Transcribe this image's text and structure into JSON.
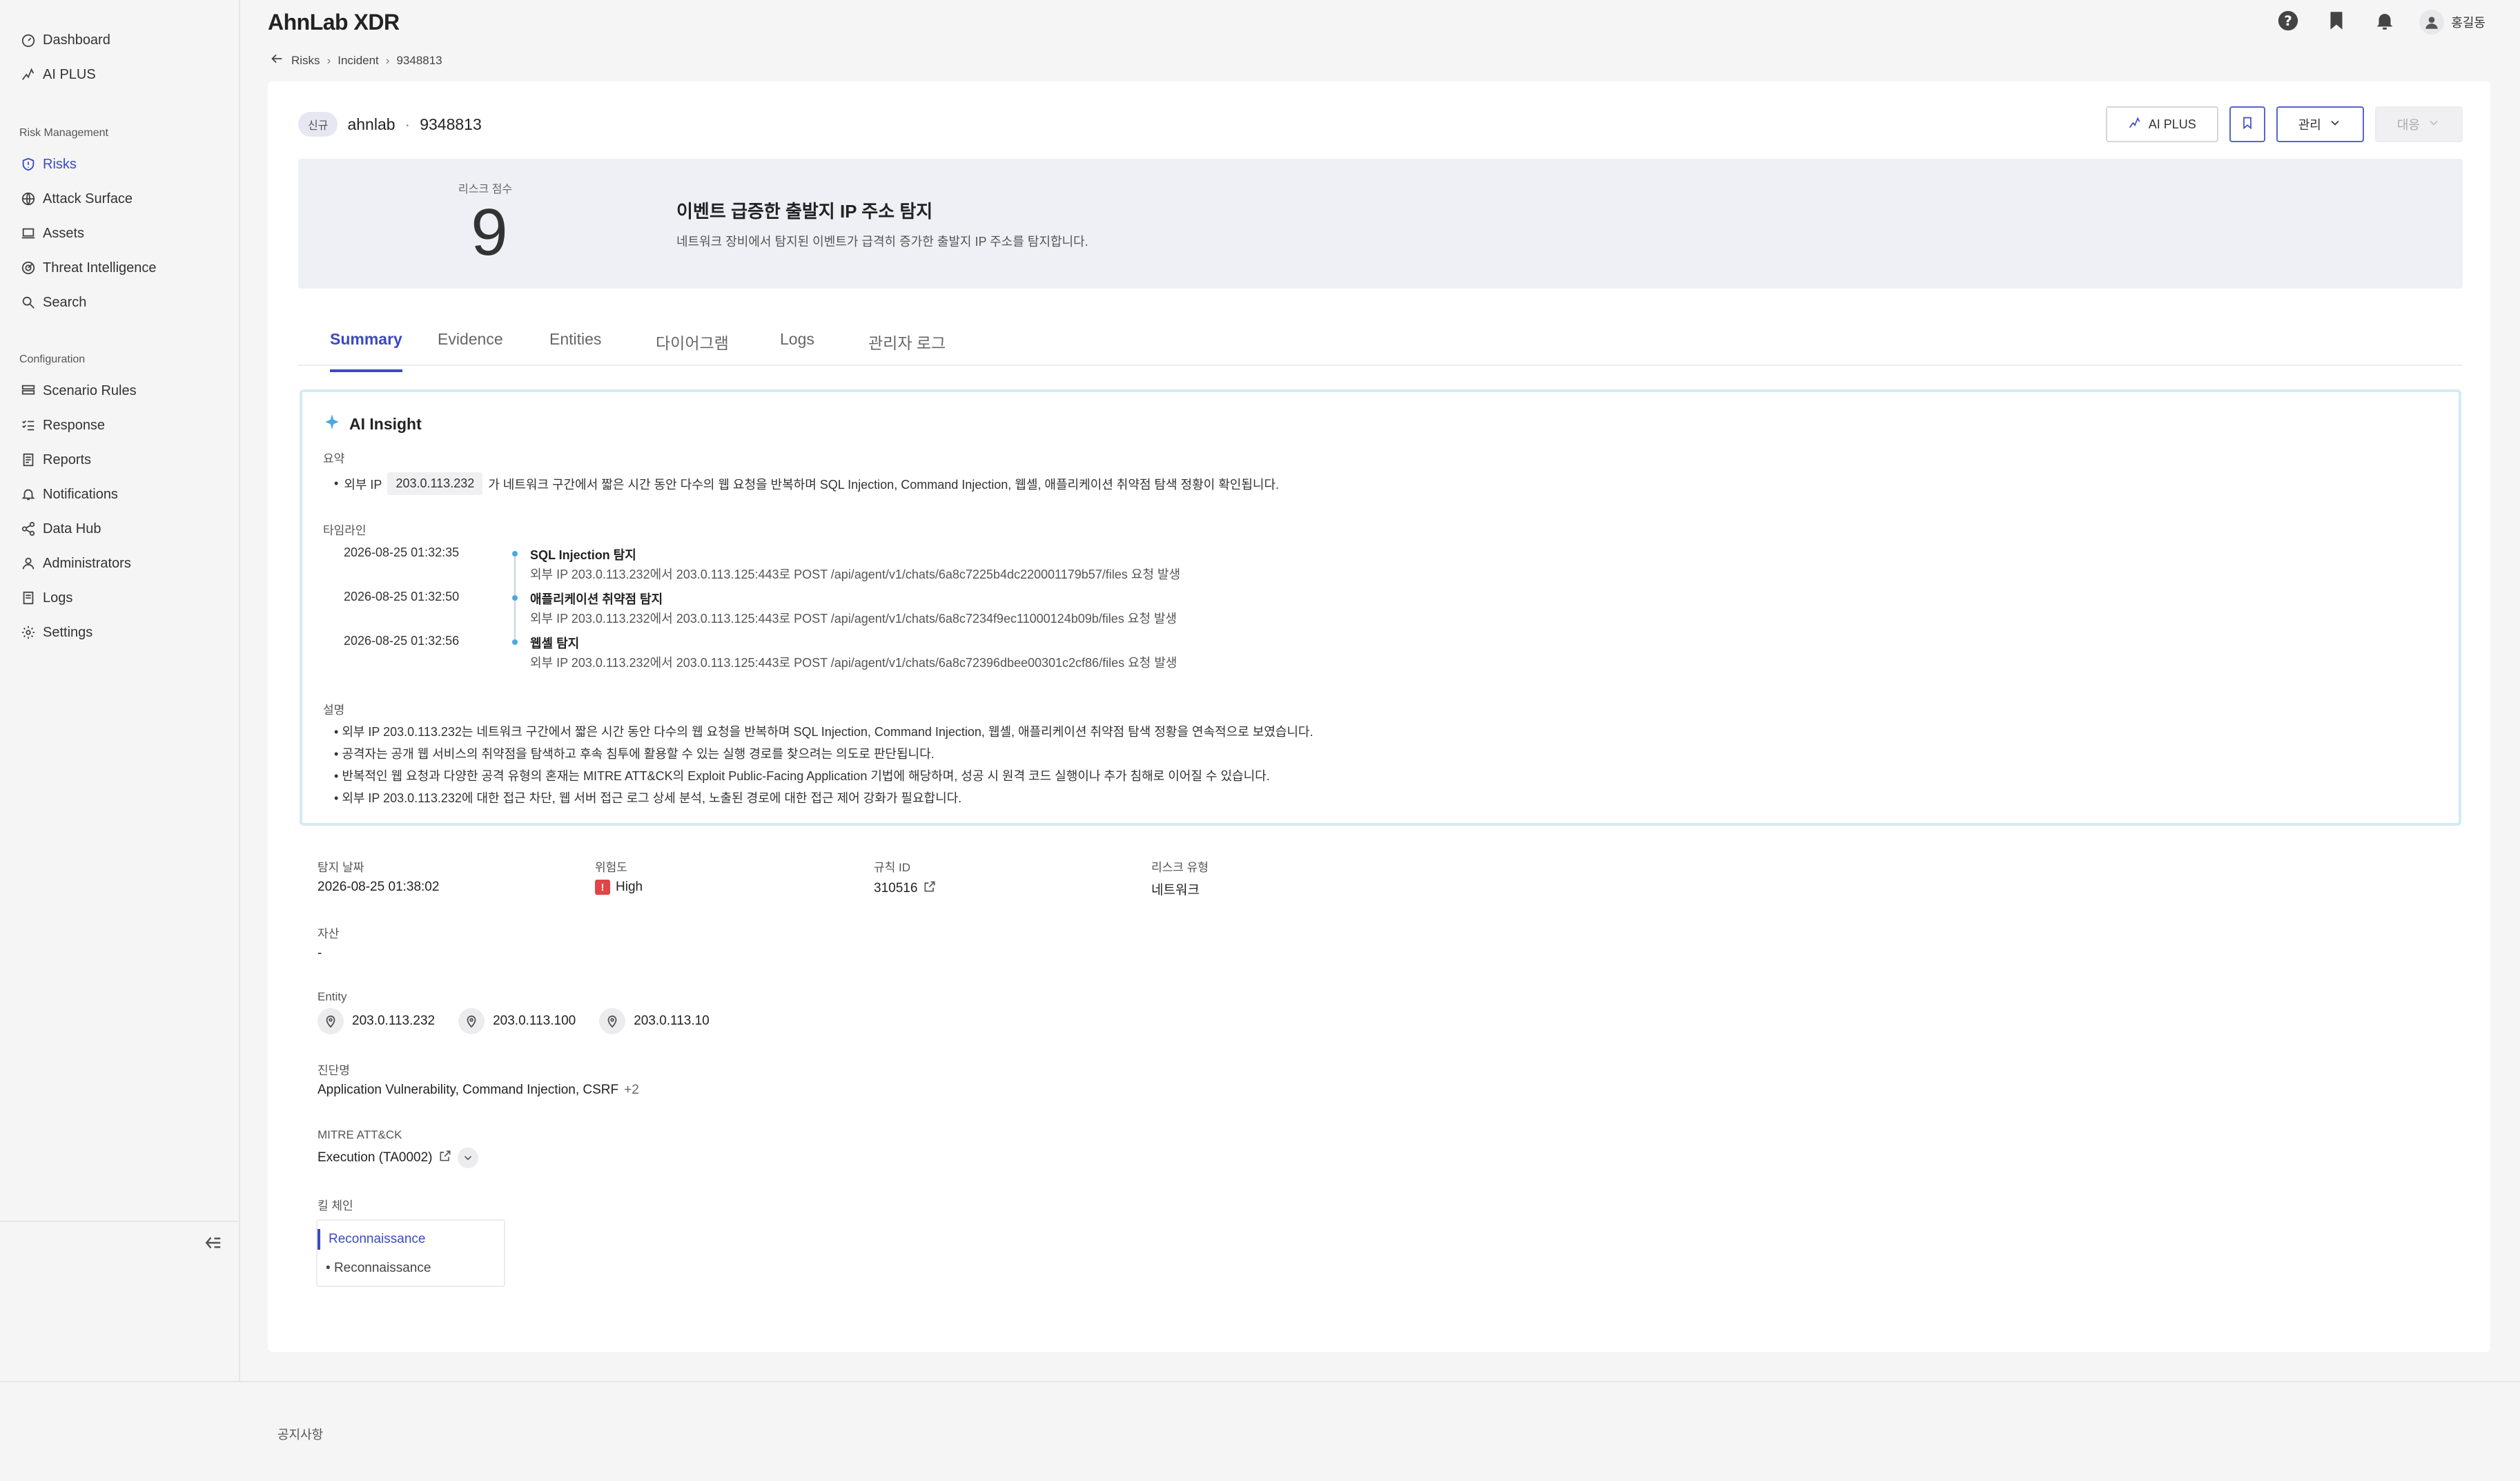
{
  "app": {
    "title": "AhnLab XDR"
  },
  "sidebar": {
    "top_items": [
      {
        "label": "Dashboard",
        "icon": "gauge-icon"
      },
      {
        "label": "AI PLUS",
        "icon": "sparkle-icon"
      }
    ],
    "risk_section": "Risk Management",
    "risk_items": [
      {
        "label": "Risks",
        "icon": "shield-icon",
        "active": true
      },
      {
        "label": "Attack Surface",
        "icon": "globe-icon"
      },
      {
        "label": "Assets",
        "icon": "laptop-icon"
      },
      {
        "label": "Threat Intelligence",
        "icon": "radar-icon"
      },
      {
        "label": "Search",
        "icon": "search-icon"
      }
    ],
    "config_section": "Configuration",
    "config_items": [
      {
        "label": "Scenario Rules",
        "icon": "stack-icon"
      },
      {
        "label": "Response",
        "icon": "checklist-icon"
      },
      {
        "label": "Reports",
        "icon": "report-icon"
      },
      {
        "label": "Notifications",
        "icon": "bell-icon"
      },
      {
        "label": "Data Hub",
        "icon": "share-icon"
      },
      {
        "label": "Administrators",
        "icon": "user-icon"
      },
      {
        "label": "Logs",
        "icon": "log-icon"
      },
      {
        "label": "Settings",
        "icon": "gear-icon"
      }
    ]
  },
  "header": {
    "user_name": "홍길동"
  },
  "breadcrumb": {
    "items": [
      "Risks",
      "Incident",
      "9348813"
    ]
  },
  "incident": {
    "status_badge": "신규",
    "tenant": "ahnlab",
    "id": "9348813",
    "actions": {
      "ai_plus": "AI PLUS",
      "manage": "관리",
      "respond": "대응"
    }
  },
  "risk": {
    "score_label": "리스크 점수",
    "score": "9",
    "title": "이벤트 급증한 출발지 IP 주소 탐지",
    "description": "네트워크 장비에서 탐지된 이벤트가 급격히 증가한 출발지 IP 주소를 탐지합니다."
  },
  "tabs": [
    "Summary",
    "Evidence",
    "Entities",
    "다이어그램",
    "Logs",
    "관리자 로그"
  ],
  "insight": {
    "title": "AI Insight",
    "summary_label": "요약",
    "summary_prefix": "외부 IP",
    "summary_ip": "203.0.113.232",
    "summary_text": "가 네트워크 구간에서 짧은 시간 동안 다수의 웹 요청을 반복하며 SQL Injection, Command Injection, 웹셸, 애플리케이션 취약점 탐색 정황이 확인됩니다.",
    "timeline_label": "타임라인",
    "timeline": [
      {
        "time": "2026-08-25 01:32:35",
        "title": "SQL Injection 탐지",
        "detail": "외부 IP 203.0.113.232에서 203.0.113.125:443로 POST /api/agent/v1/chats/6a8c7225b4dc220001179b57/files 요청 발생"
      },
      {
        "time": "2026-08-25 01:32:50",
        "title": "애플리케이션 취약점 탐지",
        "detail": "외부 IP 203.0.113.232에서 203.0.113.125:443로 POST /api/agent/v1/chats/6a8c7234f9ec11000124b09b/files 요청 발생"
      },
      {
        "time": "2026-08-25 01:32:56",
        "title": "웹셸 탐지",
        "detail": "외부 IP 203.0.113.232에서 203.0.113.125:443로 POST /api/agent/v1/chats/6a8c72396dbee00301c2cf86/files 요청 발생"
      }
    ],
    "explanation_label": "설명",
    "explanation": [
      "외부 IP 203.0.113.232는 네트워크 구간에서 짧은 시간 동안 다수의 웹 요청을 반복하며 SQL Injection, Command Injection, 웹셸, 애플리케이션 취약점 탐색 정황을 연속적으로 보였습니다.",
      "공격자는 공개 웹 서비스의 취약점을 탐색하고 후속 침투에 활용할 수 있는 실행 경로를 찾으려는 의도로 판단됩니다.",
      "반복적인 웹 요청과 다양한 공격 유형의 혼재는 MITRE ATT&CK의 Exploit Public-Facing Application 기법에 해당하며, 성공 시 원격 코드 실행이나 추가 침해로 이어질 수 있습니다.",
      "외부 IP 203.0.113.232에 대한 접근 차단, 웹 서버 접근 로그 상세 분석, 노출된 경로에 대한 접근 제어 강화가 필요합니다."
    ]
  },
  "details": {
    "detect_date_label": "탐지 날짜",
    "detect_date": "2026-08-25 01:38:02",
    "severity_label": "위험도",
    "severity": "High",
    "severity_color": "#e04646",
    "rule_id_label": "규칙 ID",
    "rule_id": "310516",
    "risk_type_label": "리스크 유형",
    "risk_type": "네트워크",
    "asset_label": "자산",
    "asset": "-",
    "entity_label": "Entity",
    "entities": [
      "203.0.113.232",
      "203.0.113.100",
      "203.0.113.10"
    ],
    "diagnosis_label": "진단명",
    "diagnosis": "Application Vulnerability, Command Injection, CSRF",
    "diagnosis_more": "+2",
    "mitre_label": "MITRE ATT&CK",
    "mitre": "Execution (TA0002)",
    "kill_chain_label": "킬 체인",
    "kill_chain_active": "Reconnaissance",
    "kill_chain_sub": "Reconnaissance"
  },
  "footer": {
    "notice": "공지사항"
  },
  "colors": {
    "accent": "#3b49c4",
    "insight_border": "#d2ecf2",
    "banner_bg": "#eef0f5"
  }
}
